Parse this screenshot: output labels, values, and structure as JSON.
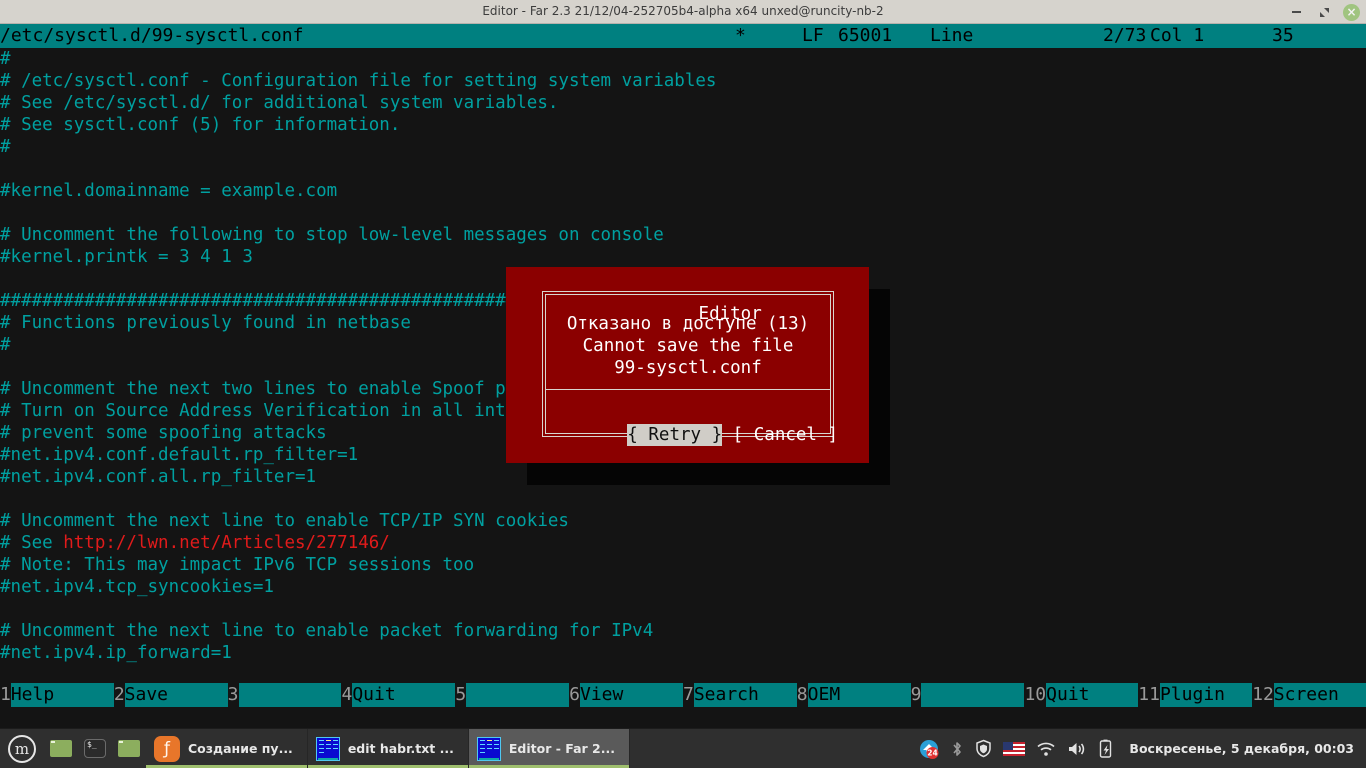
{
  "window": {
    "title": "Editor - Far 2.3 21/12/04-252705b4-alpha x64 unxed@runcity-nb-2",
    "minimize_label": "",
    "maximize_label": "",
    "close_label": "×"
  },
  "editor_status": {
    "filename": "/etc/sysctl.d/99-sysctl.conf",
    "modified_marker": "*",
    "eol": "LF",
    "codepage": "65001",
    "line_label": "Line",
    "line_value": "2/73",
    "col_label": "Col 1",
    "col_value": "35"
  },
  "editor_text": {
    "lines": [
      "#",
      "# /etc/sysctl.conf - Configuration file for setting system variables",
      "# See /etc/sysctl.d/ for additional system variables.",
      "# See sysctl.conf (5) for information.",
      "#",
      "",
      "#kernel.domainname = example.com",
      "",
      "# Uncomment the following to stop low-level messages on console",
      "#kernel.printk = 3 4 1 3",
      "",
      "##################################################################",
      "# Functions previously found in netbase",
      "#",
      "",
      "# Uncomment the next two lines to enable Spoof protection (reverse-path filter)",
      "# Turn on Source Address Verification in all interfaces to",
      "# prevent some spoofing attacks",
      "#net.ipv4.conf.default.rp_filter=1",
      "#net.ipv4.conf.all.rp_filter=1",
      "",
      "# Uncomment the next line to enable TCP/IP SYN cookies",
      "# See http://lwn.net/Articles/277146/",
      "# Note: This may impact IPv6 TCP sessions too",
      "#net.ipv4.tcp_syncookies=1",
      "",
      "# Uncomment the next line to enable packet forwarding for IPv4",
      "#net.ipv4.ip_forward=1"
    ],
    "url_line_index": 22,
    "url_prefix": "# See ",
    "url_text": "http://lwn.net/Articles/277146/"
  },
  "dialog": {
    "title": "Editor",
    "message_line1": "Отказано в доступе (13)",
    "message_line2": "Cannot save the file",
    "message_line3": "99-sysctl.conf",
    "button_retry": "{ Retry }",
    "button_cancel": "[ Cancel ]",
    "bg_color": "#8b0000",
    "focused_button": "retry"
  },
  "function_keys": [
    {
      "num": "1",
      "label": "Help"
    },
    {
      "num": "2",
      "label": "Save"
    },
    {
      "num": "3",
      "label": ""
    },
    {
      "num": "4",
      "label": "Quit"
    },
    {
      "num": "5",
      "label": ""
    },
    {
      "num": "6",
      "label": "View"
    },
    {
      "num": "7",
      "label": "Search"
    },
    {
      "num": "8",
      "label": "OEM"
    },
    {
      "num": "9",
      "label": ""
    },
    {
      "num": "10",
      "label": "Quit"
    },
    {
      "num": "11",
      "label": "Plugin"
    },
    {
      "num": "12",
      "label": "Screen"
    }
  ],
  "taskbar": {
    "menu_label": "m",
    "windows": [
      {
        "label": "Создание пу...",
        "icon": "firefox-icon",
        "active": false
      },
      {
        "label": "edit habr.txt ...",
        "icon": "far-icon",
        "active": false
      },
      {
        "label": "Editor - Far 2...",
        "icon": "far-icon",
        "active": true
      }
    ],
    "tray": {
      "updates_badge": "24",
      "keyboard_layout": "US",
      "clock": "Воскресенье, 5 декабря, 00:03"
    }
  },
  "colors": {
    "teal": "#008080",
    "editor_bg": "#141414",
    "editor_fg": "#00a0a0",
    "url_red": "#e01b1b",
    "dialog_red": "#8b0000",
    "taskbar_bg": "#2f2f2f"
  }
}
